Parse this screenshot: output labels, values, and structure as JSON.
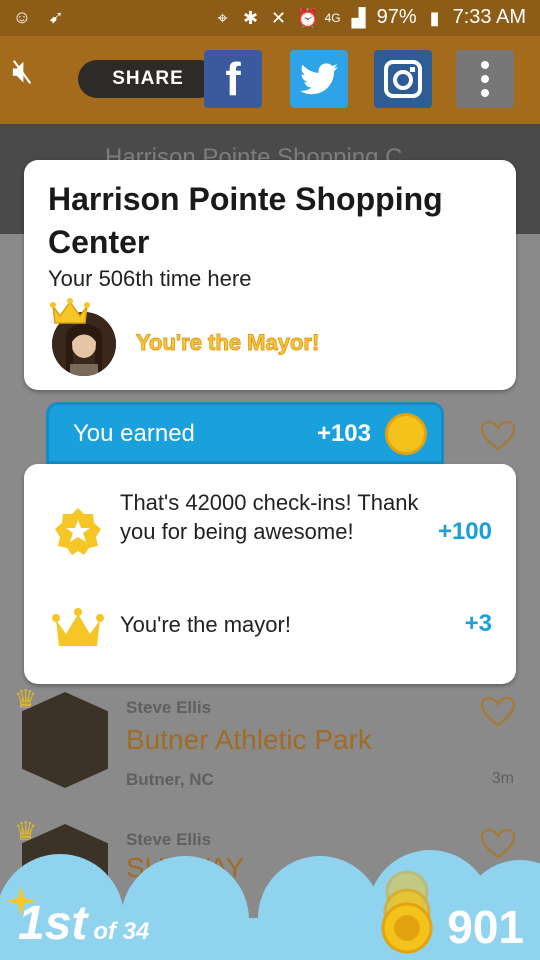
{
  "status": {
    "battery": "97%",
    "time": "7:33 AM",
    "network": "4G"
  },
  "share_bar": {
    "share_label": "SHARE"
  },
  "feed": {
    "header_venue": "Harrison Pointe Shopping C",
    "rows": [
      {
        "user": "Steve Ellis",
        "venue": "Butner Athletic Park",
        "city": "Butner, NC",
        "time": "3m"
      },
      {
        "user": "Steve Ellis",
        "venue": "SUBWAY"
      }
    ]
  },
  "checkin_card": {
    "title": "Harrison Pointe Shopping Center",
    "subtitle": "Your 506th time here",
    "mayor_text": "You're the Mayor!"
  },
  "earned": {
    "label": "You earned",
    "amount": "+103"
  },
  "bonuses": [
    {
      "text": "That's 42000 check-ins! Thank you for being awesome!",
      "points": "+100",
      "icon": "star-badge-icon"
    },
    {
      "text": "You're the mayor!",
      "points": "+3",
      "icon": "crown-icon"
    }
  ],
  "footer": {
    "rank": "1st",
    "rank_of": "of 34",
    "coins": "901"
  },
  "colors": {
    "brand_brown": "#a56b1c",
    "blue": "#1aa0dc",
    "gold": "#f4c31b",
    "cloud": "#8fd3ee"
  }
}
